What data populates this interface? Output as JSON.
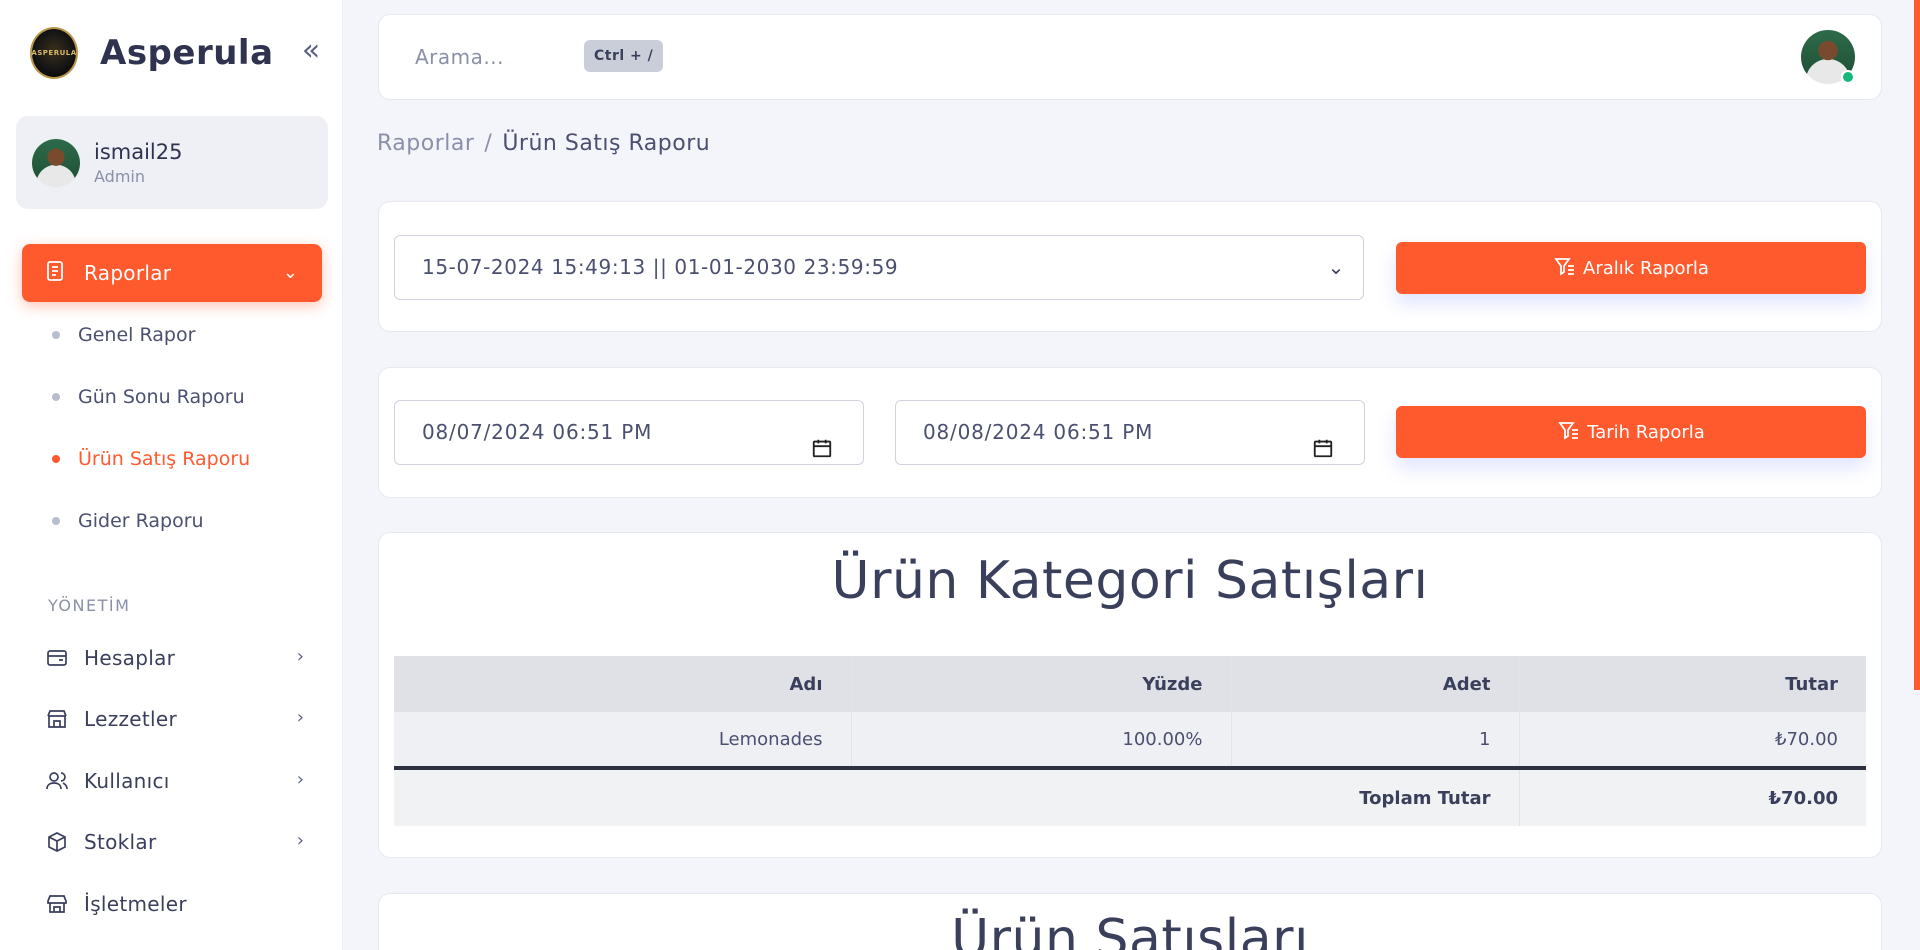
{
  "brand": {
    "name": "Asperula",
    "logo_text": "ASPERULA"
  },
  "user": {
    "name": "ismail25",
    "role": "Admin"
  },
  "sidebar": {
    "active_item": {
      "label": "Raporlar",
      "icon": "report-icon"
    },
    "sub_items": [
      {
        "label": "Genel Rapor"
      },
      {
        "label": "Gün Sonu Raporu"
      },
      {
        "label": "Ürün Satış Raporu"
      },
      {
        "label": "Gider Raporu"
      }
    ],
    "section_title": "YÖNETİM",
    "items": [
      {
        "label": "Hesaplar",
        "icon": "accounts-icon"
      },
      {
        "label": "Lezzetler",
        "icon": "store-icon"
      },
      {
        "label": "Kullanıcı",
        "icon": "users-icon"
      },
      {
        "label": "Stoklar",
        "icon": "box-icon"
      },
      {
        "label": "İşletmeler",
        "icon": "building-icon"
      }
    ]
  },
  "topbar": {
    "search_placeholder": "Arama...",
    "shortcut": "Ctrl + /"
  },
  "breadcrumb": {
    "parent": "Raporlar",
    "separator": "/",
    "current": "Ürün Satış Raporu"
  },
  "range_filter": {
    "selected": "15-07-2024 15:49:13 || 01-01-2030 23:59:59",
    "button_label": "Aralık Raporla"
  },
  "date_filter": {
    "start": "08/07/2024 06:51 PM",
    "end": "08/08/2024 06:51 PM",
    "button_label": "Tarih Raporla"
  },
  "category_sales": {
    "title": "Ürün Kategori Satışları",
    "columns": [
      "Adı",
      "Yüzde",
      "Adet",
      "Tutar"
    ],
    "rows": [
      [
        "Lemonades",
        "100.00%",
        "1",
        "₺70.00"
      ]
    ],
    "total_label": "Toplam Tutar",
    "total_value": "₺70.00"
  },
  "product_sales": {
    "title": "Ürün Satışları"
  },
  "colors": {
    "accent": "#ff5a2e",
    "text": "#3a3f5c",
    "online": "#14b87a"
  }
}
